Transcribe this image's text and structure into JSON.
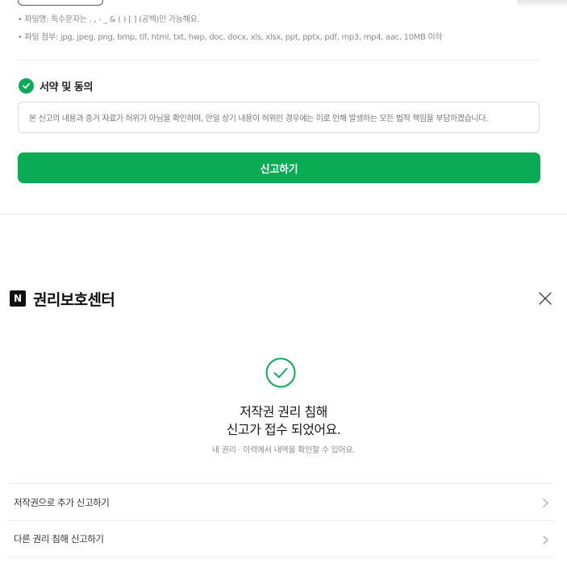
{
  "form": {
    "notes": [
      "• 파일명: 특수문자는 . , - _ & ( ) [ ] (공백)만 가능해요.",
      "• 파일 첨부: jpg, jpeg, png, bmp, tif, html, txt, hwp, doc, docx, xls, xlsx, ppt, pptx, pdf, mp3, mp4, aac, 10MB 이하"
    ],
    "consent_title": "서약 및 동의",
    "consent_text": "본 신고의 내용과 증거 자료가 허위가 아님을 확인하며, 만일 상기 내용이 허위인 경우에는 이로 인해 발생하는 모든 법적 책임을 부담하겠습니다.",
    "submit_label": "신고하기",
    "accent_color": "#0bab55"
  },
  "result": {
    "logo_letter": "N",
    "brand": "권리보호센터",
    "title_line1": "저작권 권리 침해",
    "title_line2": "신고가 접수 되었어요.",
    "subtitle": "내 권리 · 이력에서 내역을 확인할 수 있어요.",
    "items": [
      {
        "label": "저작권으로 추가 신고하기",
        "icon": "chevron-right-icon"
      },
      {
        "label": "다른 권리 침해 신고하기",
        "icon": "chevron-right-icon"
      }
    ],
    "close_icon": "close-icon",
    "status_icon": "check-circle-icon"
  }
}
